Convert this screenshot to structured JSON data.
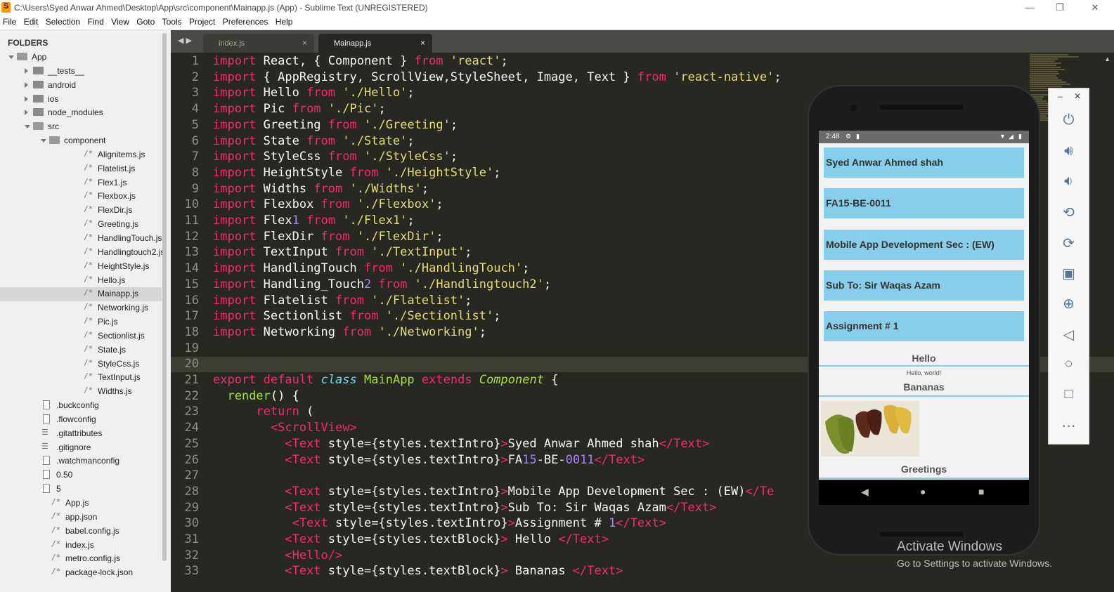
{
  "window": {
    "title": "C:\\Users\\Syed Anwar Ahmed\\Desktop\\App\\src\\component\\Mainapp.js (App) - Sublime Text (UNREGISTERED)",
    "minimize_icon": "minimize-icon",
    "maximize_icon": "restore-icon"
  },
  "menu": [
    "File",
    "Edit",
    "Selection",
    "Find",
    "View",
    "Goto",
    "Tools",
    "Project",
    "Preferences",
    "Help"
  ],
  "sidebar": {
    "header": "FOLDERS",
    "items": [
      {
        "label": "App",
        "kind": "folder-open",
        "depth": 0
      },
      {
        "label": "__tests__",
        "kind": "folder",
        "depth": 1
      },
      {
        "label": "android",
        "kind": "folder",
        "depth": 1
      },
      {
        "label": "ios",
        "kind": "folder",
        "depth": 1
      },
      {
        "label": "node_modules",
        "kind": "folder",
        "depth": 1
      },
      {
        "label": "src",
        "kind": "folder-open",
        "depth": 1
      },
      {
        "label": "component",
        "kind": "folder-open",
        "depth": 2
      },
      {
        "label": "Alignitems.js",
        "kind": "js",
        "depth": 3
      },
      {
        "label": "Flatelist.js",
        "kind": "js",
        "depth": 3
      },
      {
        "label": "Flex1.js",
        "kind": "js",
        "depth": 3
      },
      {
        "label": "Flexbox.js",
        "kind": "js",
        "depth": 3
      },
      {
        "label": "FlexDir.js",
        "kind": "js",
        "depth": 3
      },
      {
        "label": "Greeting.js",
        "kind": "js",
        "depth": 3
      },
      {
        "label": "HandlingTouch.js",
        "kind": "js",
        "depth": 3
      },
      {
        "label": "Handlingtouch2.js",
        "kind": "js",
        "depth": 3
      },
      {
        "label": "HeightStyle.js",
        "kind": "js",
        "depth": 3
      },
      {
        "label": "Hello.js",
        "kind": "js",
        "depth": 3
      },
      {
        "label": "Mainapp.js",
        "kind": "js",
        "depth": 3,
        "selected": true
      },
      {
        "label": "Networking.js",
        "kind": "js",
        "depth": 3
      },
      {
        "label": "Pic.js",
        "kind": "js",
        "depth": 3
      },
      {
        "label": "Sectionlist.js",
        "kind": "js",
        "depth": 3
      },
      {
        "label": "State.js",
        "kind": "js",
        "depth": 3
      },
      {
        "label": "StyleCss.js",
        "kind": "js",
        "depth": 3
      },
      {
        "label": "TextInput.js",
        "kind": "js",
        "depth": 3
      },
      {
        "label": "Widths.js",
        "kind": "js",
        "depth": 3
      },
      {
        "label": ".buckconfig",
        "kind": "file",
        "depth": 1
      },
      {
        "label": ".flowconfig",
        "kind": "file",
        "depth": 1
      },
      {
        "label": ".gitattributes",
        "kind": "list",
        "depth": 1
      },
      {
        "label": ".gitignore",
        "kind": "list",
        "depth": 1
      },
      {
        "label": ".watchmanconfig",
        "kind": "file",
        "depth": 1
      },
      {
        "label": "0.50",
        "kind": "file",
        "depth": 1
      },
      {
        "label": "5",
        "kind": "file",
        "depth": 1
      },
      {
        "label": "App.js",
        "kind": "js",
        "depth": 1
      },
      {
        "label": "app.json",
        "kind": "js",
        "depth": 1
      },
      {
        "label": "babel.config.js",
        "kind": "js",
        "depth": 1
      },
      {
        "label": "index.js",
        "kind": "js",
        "depth": 1
      },
      {
        "label": "metro.config.js",
        "kind": "js",
        "depth": 1
      },
      {
        "label": "package-lock.json",
        "kind": "js",
        "depth": 1
      }
    ]
  },
  "tabs": [
    {
      "label": "index.js",
      "active": false,
      "close": "×"
    },
    {
      "label": "Mainapp.js",
      "active": true,
      "close": "×"
    }
  ],
  "tab_nav": "◀ ▶",
  "editor": {
    "current_line": 20,
    "lines": [
      {
        "n": "1",
        "code": "import React, { Component } from 'react';"
      },
      {
        "n": "2",
        "code": "import { AppRegistry, ScrollView,StyleSheet, Image, Text } from 'react-native';"
      },
      {
        "n": "3",
        "code": "import Hello from './Hello';"
      },
      {
        "n": "4",
        "code": "import Pic from './Pic';"
      },
      {
        "n": "5",
        "code": "import Greeting from './Greeting';"
      },
      {
        "n": "6",
        "code": "import State from './State';"
      },
      {
        "n": "7",
        "code": "import StyleCss from './StyleCss';"
      },
      {
        "n": "8",
        "code": "import HeightStyle from './HeightStyle';"
      },
      {
        "n": "9",
        "code": "import Widths from './Widths';"
      },
      {
        "n": "10",
        "code": "import Flexbox from './Flexbox';"
      },
      {
        "n": "11",
        "code": "import Flex1 from './Flex1';"
      },
      {
        "n": "12",
        "code": "import FlexDir from './FlexDir';"
      },
      {
        "n": "13",
        "code": "import TextInput from './TextInput';"
      },
      {
        "n": "14",
        "code": "import HandlingTouch from './HandlingTouch';"
      },
      {
        "n": "15",
        "code": "import Handling_Touch2 from './Handlingtouch2';"
      },
      {
        "n": "16",
        "code": "import Flatelist from './Flatelist';"
      },
      {
        "n": "17",
        "code": "import Sectionlist from './Sectionlist';"
      },
      {
        "n": "18",
        "code": "import Networking from './Networking';"
      },
      {
        "n": "19",
        "code": ""
      },
      {
        "n": "20",
        "code": ""
      },
      {
        "n": "21",
        "code": "export default class MainApp extends Component {"
      },
      {
        "n": "22",
        "code": "  render() {"
      },
      {
        "n": "23",
        "code": "      return ("
      },
      {
        "n": "24",
        "code": "        <ScrollView>"
      },
      {
        "n": "25",
        "code": "          <Text style={styles.textIntro}>Syed Anwar Ahmed shah</Text>"
      },
      {
        "n": "26",
        "code": "          <Text style={styles.textIntro}>FA15-BE-0011</Text>"
      },
      {
        "n": "27",
        "code": ""
      },
      {
        "n": "28",
        "code": "          <Text style={styles.textIntro}>Mobile App Development Sec : (EW)</Te"
      },
      {
        "n": "29",
        "code": "          <Text style={styles.textIntro}>Sub To: Sir Waqas Azam</Text>"
      },
      {
        "n": "30",
        "code": "           <Text style={styles.textIntro}>Assignment # 1</Text>"
      },
      {
        "n": "31",
        "code": "          <Text style={styles.textBlock}> Hello </Text>"
      },
      {
        "n": "32",
        "code": "          <Hello/>"
      },
      {
        "n": "33",
        "code": "          <Text style={styles.textBlock}> Bananas </Text>"
      }
    ]
  },
  "emulator": {
    "status_time": "2:48",
    "cards": [
      "Syed Anwar Ahmed shah",
      "FA15-BE-0011",
      "Mobile App Development Sec : (EW)",
      "Sub To: Sir Waqas Azam",
      "Assignment # 1"
    ],
    "hello_header": "Hello",
    "hello_text": "Hello, world!",
    "bananas_header": "Bananas",
    "greetings_header": "Greetings",
    "card_color": "#87ceeb",
    "toolbar": [
      "power-icon",
      "volume-up-icon",
      "volume-down-icon",
      "rotate-left-icon",
      "rotate-right-icon",
      "camera-icon",
      "zoom-icon",
      "back-icon",
      "home-icon",
      "overview-icon",
      "more-icon"
    ]
  },
  "watermark": {
    "line1": "Activate Windows",
    "line2": "Go to Settings to activate Windows."
  },
  "colors": {
    "editor_bg": "#272822",
    "keyword": "#f92672",
    "string": "#e6db74",
    "function": "#a6e22e",
    "storage": "#66d9ef"
  }
}
